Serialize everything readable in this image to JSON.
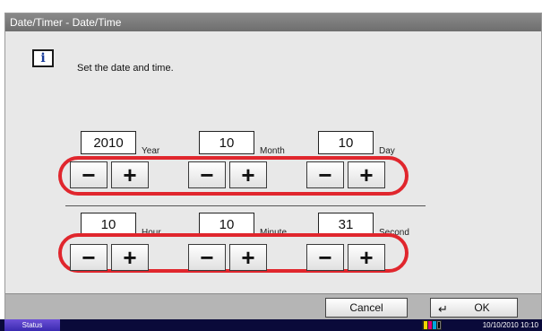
{
  "window": {
    "title": "Date/Timer - Date/Time"
  },
  "info": {
    "icon": "info-icon",
    "message": "Set the date and time."
  },
  "date": {
    "year": {
      "value": "2010",
      "unit": "Year"
    },
    "month": {
      "value": "10",
      "unit": "Month"
    },
    "day": {
      "value": "10",
      "unit": "Day"
    }
  },
  "time": {
    "hour": {
      "value": "10",
      "unit": "Hour"
    },
    "minute": {
      "value": "10",
      "unit": "Minute"
    },
    "second": {
      "value": "31",
      "unit": "Second"
    }
  },
  "buttons": {
    "minus": "−",
    "plus": "+"
  },
  "footer": {
    "cancel": "Cancel",
    "ok": "OK",
    "ok_icon": "enter-icon"
  },
  "status": {
    "label": "Status",
    "datetime": "10/10/2010  10:10"
  },
  "colors": {
    "highlight": "#e0262d",
    "titlebar": "#7a7a7a"
  }
}
